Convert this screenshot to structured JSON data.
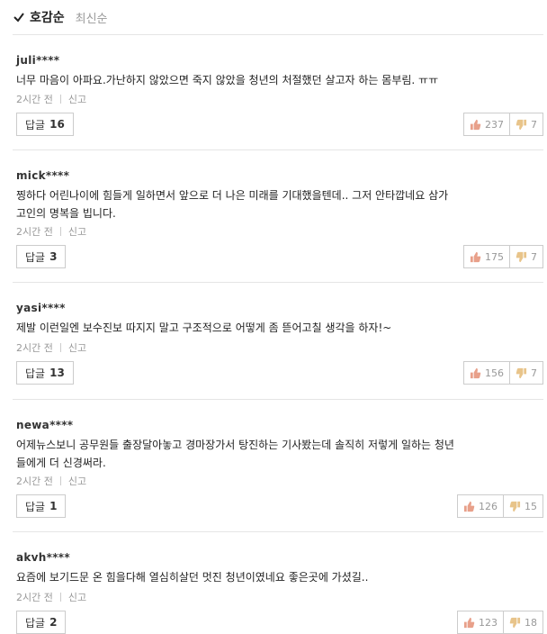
{
  "sort": {
    "active": "호감순",
    "other": "최신순"
  },
  "comments": [
    {
      "user": "juli****",
      "lines": [
        "너무 마음이 아파요.가난하지 않았으면 죽지 않았을 청년의 처절했던 살고자 하는 몸부림. ㅠㅠ"
      ],
      "time": "2시간 전",
      "report": "신고",
      "reply_label": "답글",
      "reply_count": "16",
      "likes": "237",
      "dislikes": "7"
    },
    {
      "user": "mick****",
      "lines": [
        "찡하다 어린나이에 힘들게 일하면서 앞으로 더 나은 미래를 기대했을텐데.. 그저 안타깝네요 삼가",
        "고인의 명복을 빕니다."
      ],
      "time": "2시간 전",
      "report": "신고",
      "reply_label": "답글",
      "reply_count": "3",
      "likes": "175",
      "dislikes": "7"
    },
    {
      "user": "yasi****",
      "lines": [
        "제발 이런일엔 보수진보 따지지 말고 구조적으로 어떻게 좀 뜯어고칠 생각을 하자!~"
      ],
      "time": "2시간 전",
      "report": "신고",
      "reply_label": "답글",
      "reply_count": "13",
      "likes": "156",
      "dislikes": "7"
    },
    {
      "user": "newa****",
      "lines": [
        "어제뉴스보니 공무원들 출장달아놓고 경마장가서 탕진하는 기사봤는데 솔직히 저렇게 일하는 청년",
        "들에게 더 신경써라."
      ],
      "time": "2시간 전",
      "report": "신고",
      "reply_label": "답글",
      "reply_count": "1",
      "likes": "126",
      "dislikes": "15"
    },
    {
      "user": "akvh****",
      "lines": [
        "요즘에 보기드문 온 힘을다해 열심히살던 멋진 청년이였네요 좋은곳에 가셨길.."
      ],
      "time": "2시간 전",
      "report": "신고",
      "reply_label": "답글",
      "reply_count": "2",
      "likes": "123",
      "dislikes": "18"
    }
  ]
}
